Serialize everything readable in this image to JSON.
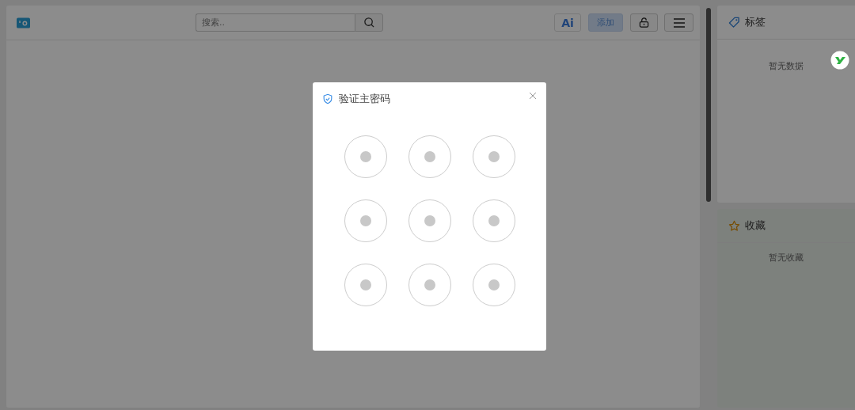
{
  "header": {
    "search": {
      "placeholder": "搜索.."
    },
    "ai_button": "Ai",
    "add_button": "添加"
  },
  "sidebar": {
    "tags": {
      "title": "标签",
      "empty": "暂无数据"
    },
    "favorites": {
      "title": "收藏",
      "empty": "暂无收藏"
    }
  },
  "dialog": {
    "title": "验证主密码",
    "pattern": [
      {
        "selected": false
      },
      {
        "selected": false
      },
      {
        "selected": false
      },
      {
        "selected": false
      },
      {
        "selected": false
      },
      {
        "selected": false
      },
      {
        "selected": false
      },
      {
        "selected": false
      },
      {
        "selected": false
      }
    ]
  }
}
